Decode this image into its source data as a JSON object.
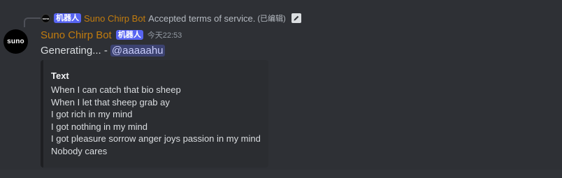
{
  "reply": {
    "avatar_text": "suno",
    "bot_tag": "机器人",
    "author": "Suno Chirp Bot",
    "text": "Accepted terms of service.",
    "edited": "(已编辑)",
    "icon": "edit-pencil-icon"
  },
  "message": {
    "avatar_text": "suno",
    "author": "Suno Chirp Bot",
    "bot_tag": "机器人",
    "timestamp": "今天22:53",
    "content": "Generating... -",
    "mention": "@aaaaahu"
  },
  "embed": {
    "field_name": "Text",
    "lines": [
      "When I can catch that bio sheep",
      "When I let that sheep grab ay",
      "I got rich in my mind",
      "I got nothing in my mind",
      "I got pleasure sorrow anger joys passion in my mind",
      "Nobody cares"
    ]
  },
  "colors": {
    "author": "#c27c0e",
    "bot_tag": "#5865f2",
    "mention_bg": "#3c4270",
    "background": "#313338"
  }
}
